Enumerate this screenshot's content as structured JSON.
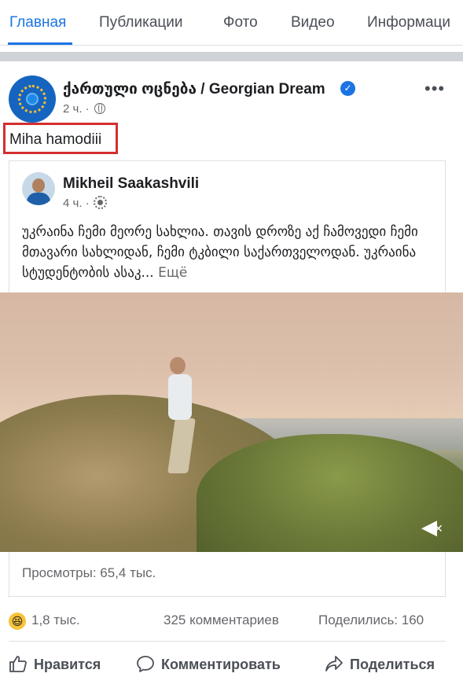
{
  "tabs": [
    {
      "label": "Главная",
      "active": true
    },
    {
      "label": "Публикации",
      "active": false
    },
    {
      "label": "Фото",
      "active": false
    },
    {
      "label": "Видео",
      "active": false
    },
    {
      "label": "Информаци",
      "active": false
    }
  ],
  "post": {
    "author": "ქართული ოცნება / Georgian Dream",
    "verified": true,
    "time": "2 ч. ·",
    "caption": "Miha hamodiii",
    "more_icon": "more-dots-icon"
  },
  "shared_post": {
    "author": "Mikheil Saakashvili",
    "time": "4 ч. ·",
    "text": "უკრაინა ჩემი მეორე სახლია. თავის დროზე აქ ჩამოვედი ჩემი მთავარი სახლიდან, ჩემი ტკბილი საქართველოდან. უკრაინა სტუდენტობის ასაკ...",
    "more_label": "Ещё",
    "views": "Просмотры: 65,4 тыс."
  },
  "reactions": {
    "emoji": "😆",
    "count": "1,8 тыс.",
    "comments": "325 комментариев",
    "shares": "Поделились: 160"
  },
  "actions": {
    "like": "Нравится",
    "comment": "Комментировать",
    "share": "Поделиться"
  },
  "colors": {
    "accent": "#1b74e4",
    "highlight_box": "#d32f2f"
  }
}
